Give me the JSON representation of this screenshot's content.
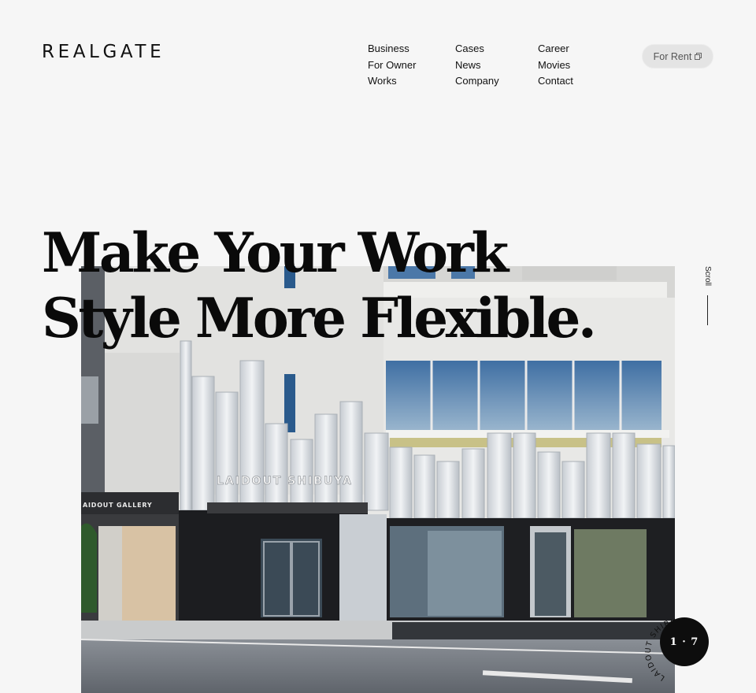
{
  "header": {
    "logo": "REALGATE",
    "nav_columns": [
      [
        "Business",
        "For Owner",
        "Works"
      ],
      [
        "Cases",
        "News",
        "Company"
      ],
      [
        "Career",
        "Movies",
        "Contact"
      ]
    ],
    "rent_button": "For Rent"
  },
  "hero": {
    "headline_line1": "Make Your Work",
    "headline_line2": "Style More Flexible.",
    "scroll_label": "Scroll",
    "slide_counter": "1 · 7",
    "slide_caption": "LAIDOUT SHIBUYA",
    "photo_signage_main": "LAIDOUT SHIBUYA",
    "photo_signage_gallery": "AIDOUT GALLERY"
  },
  "colors": {
    "background": "#f6f6f6",
    "text": "#111111",
    "button_bg": "#e4e4e4"
  }
}
